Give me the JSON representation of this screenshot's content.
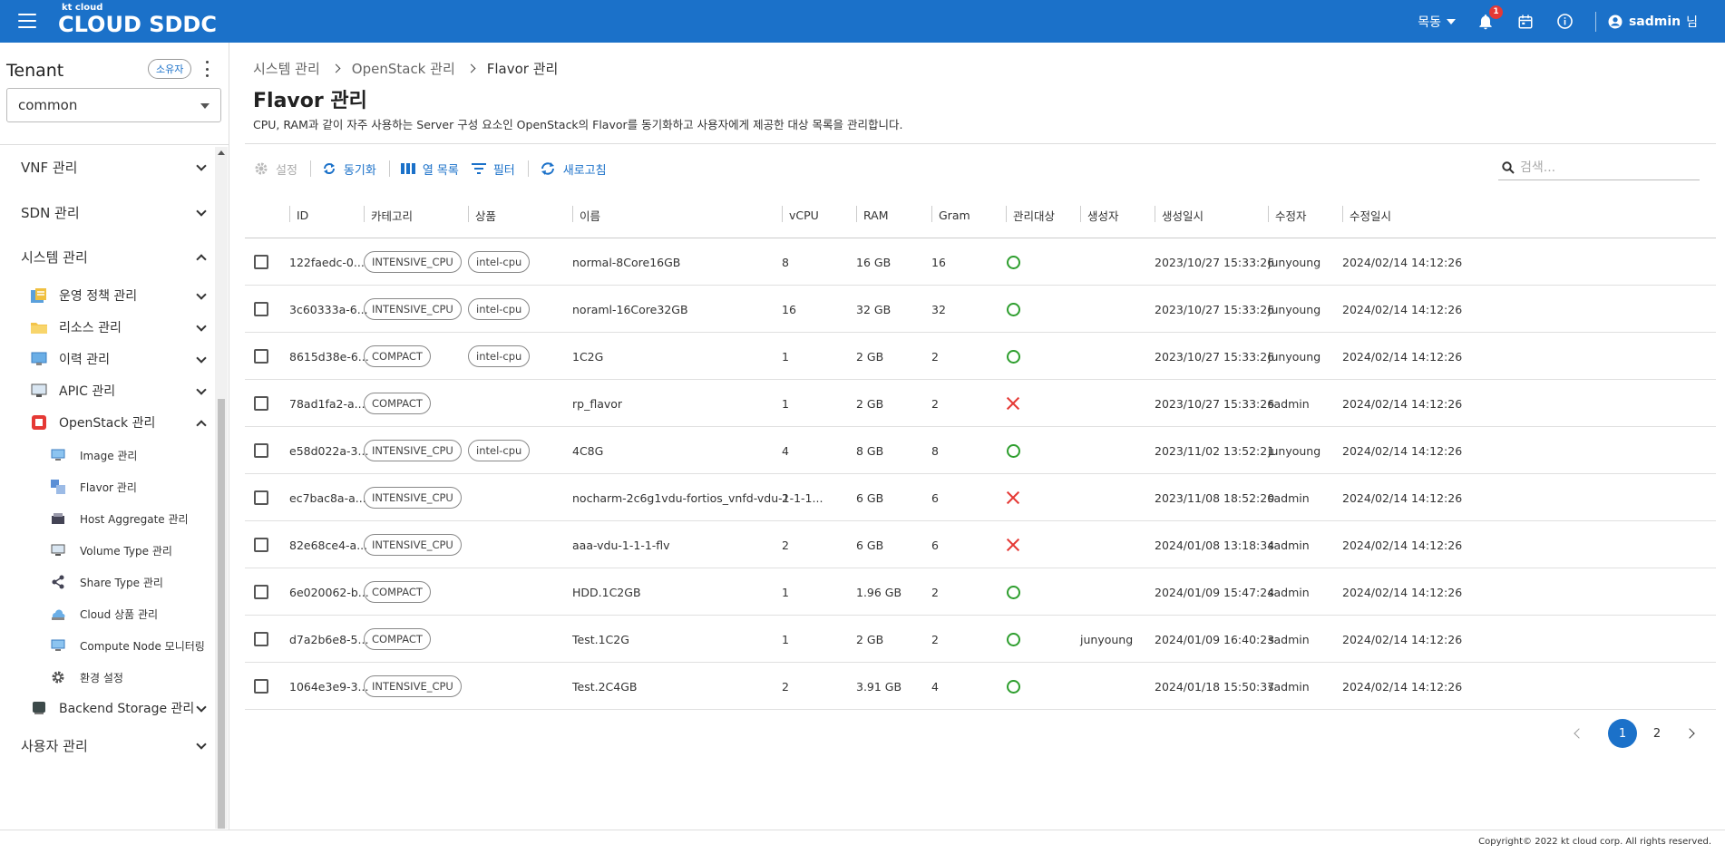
{
  "header": {
    "logo_small": "kt cloud",
    "logo_big": "CLOUD SDDC",
    "region": "목동",
    "notification_count": "1",
    "user_name": "sadmin",
    "user_suffix": "님",
    "bar_color": "#1b71c9"
  },
  "sidebar": {
    "tenant_title": "Tenant",
    "owner_chip": "소유자",
    "tenant_value": "common",
    "menu": {
      "vnf": "VNF 관리",
      "sdn": "SDN 관리",
      "system": "시스템 관리",
      "ops_policy": "운영 정책 관리",
      "resource": "리소스 관리",
      "history": "이력 관리",
      "apic": "APIC 관리",
      "openstack": "OpenStack 관리",
      "image": "Image 관리",
      "flavor": "Flavor 관리",
      "host_aggregate": "Host Aggregate 관리",
      "volume_type": "Volume Type 관리",
      "share_type": "Share Type 관리",
      "cloud_product": "Cloud 상품 관리",
      "compute_node": "Compute Node 모니터링",
      "env_settings": "환경 설정",
      "backend_storage": "Backend Storage 관리",
      "user_mgmt": "사용자 관리"
    }
  },
  "breadcrumb": [
    "시스템 관리",
    "OpenStack 관리",
    "Flavor 관리"
  ],
  "page": {
    "title": "Flavor 관리",
    "description": "CPU, RAM과 같이 자주 사용하는 Server 구성 요소인 OpenStack의 Flavor를 동기화하고 사용자에게 제공한 대상 목록을 관리합니다."
  },
  "toolbar": {
    "settings": "설정",
    "sync": "동기화",
    "columns": "열 목록",
    "filter": "필터",
    "refresh": "새로고침",
    "search_placeholder": "검색..."
  },
  "table": {
    "headers": {
      "id": "ID",
      "category": "카테고리",
      "product": "상품",
      "name": "이름",
      "vcpu": "vCPU",
      "ram": "RAM",
      "gram": "Gram",
      "managed": "관리대상",
      "creator": "생성자",
      "created": "생성일시",
      "modifier": "수정자",
      "modified": "수정일시"
    },
    "rows": [
      {
        "id": "122faedc-0...",
        "category": "INTENSIVE_CPU",
        "product": "intel-cpu",
        "name": "normal-8Core16GB",
        "vcpu": "8",
        "ram": "16 GB",
        "gram": "16",
        "managed": true,
        "creator": "",
        "created": "2023/10/27 15:33:26",
        "modifier": "junyoung",
        "modified": "2024/02/14 14:12:26"
      },
      {
        "id": "3c60333a-6...",
        "category": "INTENSIVE_CPU",
        "product": "intel-cpu",
        "name": "noraml-16Core32GB",
        "vcpu": "16",
        "ram": "32 GB",
        "gram": "32",
        "managed": true,
        "creator": "",
        "created": "2023/10/27 15:33:26",
        "modifier": "junyoung",
        "modified": "2024/02/14 14:12:26"
      },
      {
        "id": "8615d38e-6...",
        "category": "COMPACT",
        "product": "intel-cpu",
        "name": "1C2G",
        "vcpu": "1",
        "ram": "2 GB",
        "gram": "2",
        "managed": true,
        "creator": "",
        "created": "2023/10/27 15:33:26",
        "modifier": "junyoung",
        "modified": "2024/02/14 14:12:26"
      },
      {
        "id": "78ad1fa2-a...",
        "category": "COMPACT",
        "product": "",
        "name": "rp_flavor",
        "vcpu": "1",
        "ram": "2 GB",
        "gram": "2",
        "managed": false,
        "creator": "",
        "created": "2023/10/27 15:33:26",
        "modifier": "sadmin",
        "modified": "2024/02/14 14:12:26"
      },
      {
        "id": "e58d022a-3...",
        "category": "INTENSIVE_CPU",
        "product": "intel-cpu",
        "name": "4C8G",
        "vcpu": "4",
        "ram": "8 GB",
        "gram": "8",
        "managed": true,
        "creator": "",
        "created": "2023/11/02 13:52:21",
        "modifier": "junyoung",
        "modified": "2024/02/14 14:12:26"
      },
      {
        "id": "ec7bac8a-a...",
        "category": "INTENSIVE_CPU",
        "product": "",
        "name": "nocharm-2c6g1vdu-fortios_vnfd-vdu-1-1-1...",
        "vcpu": "2",
        "ram": "6 GB",
        "gram": "6",
        "managed": false,
        "creator": "",
        "created": "2023/11/08 18:52:20",
        "modifier": "sadmin",
        "modified": "2024/02/14 14:12:26"
      },
      {
        "id": "82e68ce4-a...",
        "category": "INTENSIVE_CPU",
        "product": "",
        "name": "aaa-vdu-1-1-1-flv",
        "vcpu": "2",
        "ram": "6 GB",
        "gram": "6",
        "managed": false,
        "creator": "",
        "created": "2024/01/08 13:18:34",
        "modifier": "sadmin",
        "modified": "2024/02/14 14:12:26"
      },
      {
        "id": "6e020062-b...",
        "category": "COMPACT",
        "product": "",
        "name": "HDD.1C2GB",
        "vcpu": "1",
        "ram": "1.96 GB",
        "gram": "2",
        "managed": true,
        "creator": "",
        "created": "2024/01/09 15:47:24",
        "modifier": "sadmin",
        "modified": "2024/02/14 14:12:26"
      },
      {
        "id": "d7a2b6e8-5...",
        "category": "COMPACT",
        "product": "",
        "name": "Test.1C2G",
        "vcpu": "1",
        "ram": "2 GB",
        "gram": "2",
        "managed": true,
        "creator": "junyoung",
        "created": "2024/01/09 16:40:23",
        "modifier": "sadmin",
        "modified": "2024/02/14 14:12:26"
      },
      {
        "id": "1064e3e9-3...",
        "category": "INTENSIVE_CPU",
        "product": "",
        "name": "Test.2C4GB",
        "vcpu": "2",
        "ram": "3.91 GB",
        "gram": "4",
        "managed": true,
        "creator": "",
        "created": "2024/01/18 15:50:37",
        "modifier": "sadmin",
        "modified": "2024/02/14 14:12:26"
      }
    ]
  },
  "pagination": {
    "pages": [
      "1",
      "2"
    ],
    "current": "1"
  },
  "footer": {
    "copyright": "Copyright© 2022 kt cloud corp. All rights reserved."
  }
}
